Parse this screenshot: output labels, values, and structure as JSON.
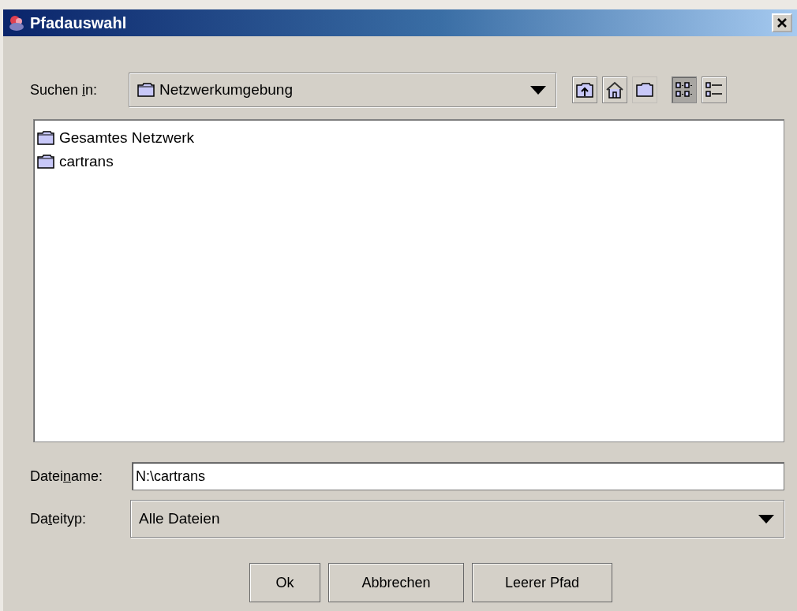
{
  "window": {
    "title": "Pfadauswahl"
  },
  "look_in": {
    "label": {
      "before": "Suchen ",
      "mnemonic": "i",
      "after": "n:"
    },
    "value": "Netzwerkumgebung"
  },
  "toolbar": [
    {
      "kind": "up",
      "disabled": false,
      "selected": false
    },
    {
      "kind": "home",
      "disabled": false,
      "selected": false
    },
    {
      "kind": "new-folder",
      "disabled": true,
      "selected": false
    },
    {
      "kind": "list",
      "disabled": false,
      "selected": true
    },
    {
      "kind": "details",
      "disabled": false,
      "selected": false
    }
  ],
  "files": [
    {
      "name": "Gesamtes Netzwerk",
      "selected": false
    },
    {
      "name": "cartrans",
      "selected": false
    }
  ],
  "file_name": {
    "label": {
      "before": "Datei",
      "mnemonic": "n",
      "after": "ame:"
    },
    "value": "N:\\cartrans"
  },
  "file_type": {
    "label": {
      "before": "Da",
      "mnemonic": "t",
      "after": "eityp:"
    },
    "value": "Alle Dateien"
  },
  "buttons": [
    "Ok",
    "Abbrechen",
    "Leerer Pfad"
  ]
}
